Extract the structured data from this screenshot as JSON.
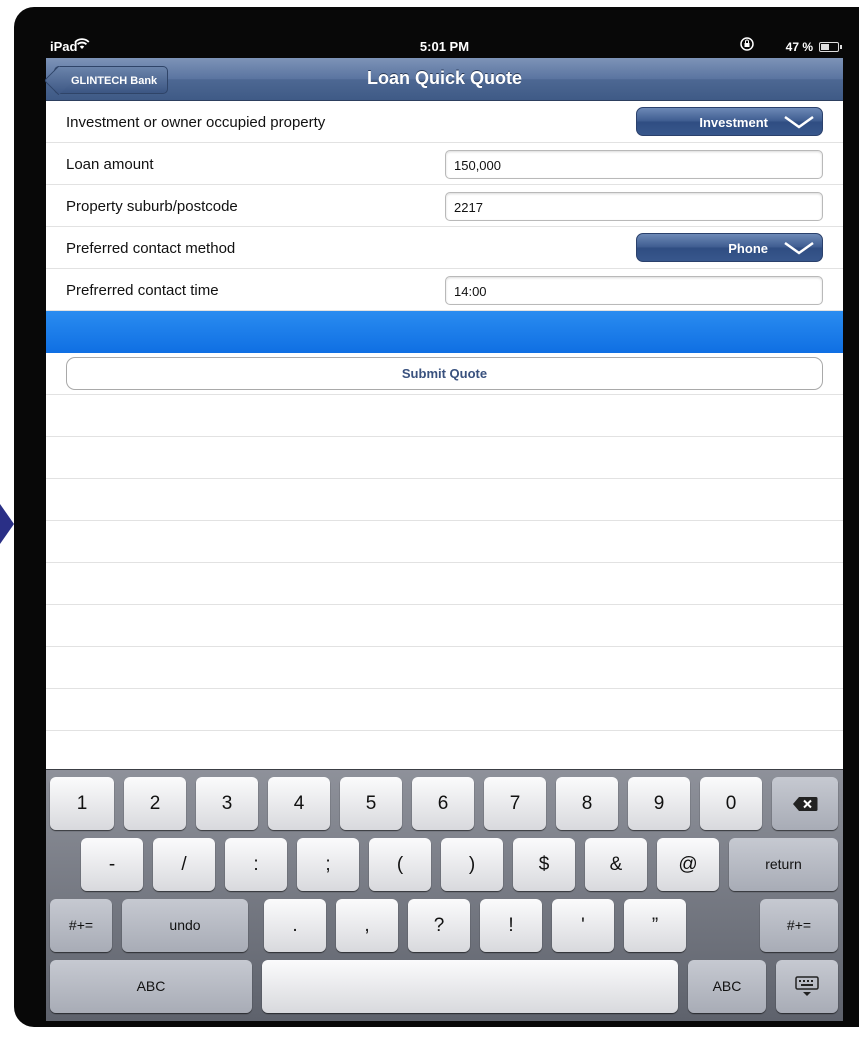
{
  "status_bar": {
    "carrier": "iPad",
    "wifi_icon": "wifi-icon",
    "time": "5:01 PM",
    "lock_icon": "orientation-lock-icon",
    "battery_text": "47 %",
    "battery_icon": "battery-icon",
    "battery_level": 0.47
  },
  "nav": {
    "back_label": "GLINTECH Bank",
    "title": "Loan Quick Quote"
  },
  "form": {
    "property_type": {
      "label": "Investment or owner occupied property",
      "value": "Investment"
    },
    "loan_amount": {
      "label": "Loan amount",
      "value": "150,000"
    },
    "suburb": {
      "label": "Property suburb/postcode",
      "value": "2217"
    },
    "contact_method": {
      "label": "Preferred contact method",
      "value": "Phone"
    },
    "contact_time": {
      "label": "Prefrerred contact time",
      "value": "14:00"
    },
    "submit_label": "Submit Quote"
  },
  "keyboard": {
    "row1": [
      "1",
      "2",
      "3",
      "4",
      "5",
      "6",
      "7",
      "8",
      "9",
      "0"
    ],
    "row2": [
      "-",
      "/",
      ":",
      ";",
      "(",
      ")",
      "$",
      "&",
      "@"
    ],
    "return_label": "return",
    "symbols_left": "#+=",
    "undo_label": "undo",
    "row3": [
      ".",
      ",",
      "?",
      "!",
      "'",
      "”"
    ],
    "symbols_right": "#+=",
    "abc_left": "ABC",
    "abc_right": "ABC",
    "backspace_icon": "backspace-icon",
    "dismiss_icon": "keyboard-dismiss-icon"
  },
  "colors": {
    "nav_blue": "#4d6893",
    "dropdown_blue": "#3d5b8f",
    "band_blue": "#1a7cea",
    "submit_text": "#39517e"
  }
}
